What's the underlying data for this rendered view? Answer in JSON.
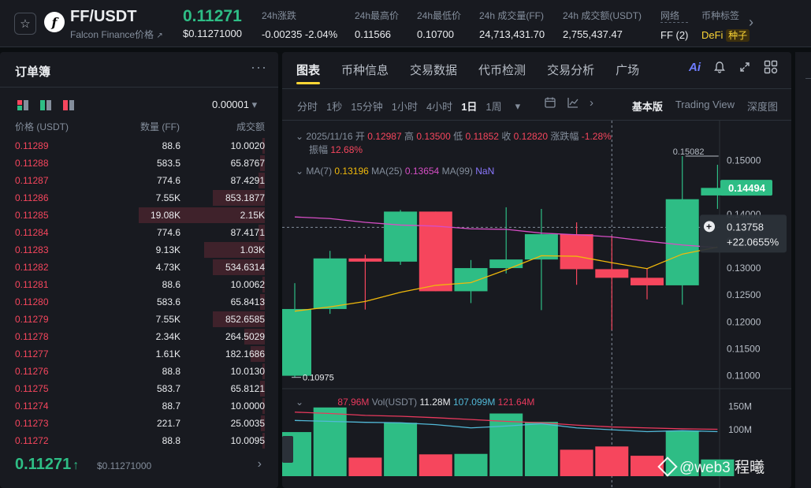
{
  "header": {
    "pair": "FF/USDT",
    "coin_name": "Falcon Finance价格",
    "coin_name_arrow": "↗",
    "logo_letter": "f",
    "last_price": "0.11271",
    "last_price_usd": "$0.11271000",
    "stats": [
      {
        "label": "24h涨跌",
        "value": "-0.00235 -2.04%",
        "tone": "down"
      },
      {
        "label": "24h最高价",
        "value": "0.11566",
        "tone": "neutral"
      },
      {
        "label": "24h最低价",
        "value": "0.10700",
        "tone": "neutral"
      },
      {
        "label": "24h 成交量(FF)",
        "value": "24,713,431.70",
        "tone": "neutral"
      },
      {
        "label": "24h 成交额(USDT)",
        "value": "2,755,437.47",
        "tone": "neutral"
      },
      {
        "label": "网络",
        "value": "FF (2)",
        "tone": "neutral"
      }
    ],
    "tags_label": "币种标签",
    "tag_defi": "DeFi",
    "tag_seed": "种子",
    "icons": {
      "favorite": "star-icon",
      "more": "chevron-right-icon"
    }
  },
  "orderbook": {
    "title": "订单簿",
    "more": "···",
    "precision": "0.00001",
    "precision_arrow": "▾",
    "columns": {
      "price": "价格 (USDT)",
      "qty": "数量 (FF)",
      "total": "成交额"
    },
    "asks": [
      {
        "price": "0.11289",
        "qty": "88.6",
        "total": "10.0020",
        "depth": 0.02
      },
      {
        "price": "0.11288",
        "qty": "583.5",
        "total": "65.8767",
        "depth": 0.04
      },
      {
        "price": "0.11287",
        "qty": "774.6",
        "total": "87.4291",
        "depth": 0.05
      },
      {
        "price": "0.11286",
        "qty": "7.55K",
        "total": "853.1877",
        "depth": 0.41
      },
      {
        "price": "0.11285",
        "qty": "19.08K",
        "total": "2.15K",
        "depth": 1.0
      },
      {
        "price": "0.11284",
        "qty": "774.6",
        "total": "87.4171",
        "depth": 0.05
      },
      {
        "price": "0.11283",
        "qty": "9.13K",
        "total": "1.03K",
        "depth": 0.48
      },
      {
        "price": "0.11282",
        "qty": "4.73K",
        "total": "534.6314",
        "depth": 0.41
      },
      {
        "price": "0.11281",
        "qty": "88.6",
        "total": "10.0062",
        "depth": 0.02
      },
      {
        "price": "0.11280",
        "qty": "583.6",
        "total": "65.8413",
        "depth": 0.04
      },
      {
        "price": "0.11279",
        "qty": "7.55K",
        "total": "852.6585",
        "depth": 0.41
      },
      {
        "price": "0.11278",
        "qty": "2.34K",
        "total": "264.5029",
        "depth": 0.16
      },
      {
        "price": "0.11277",
        "qty": "1.61K",
        "total": "182.1686",
        "depth": 0.11
      },
      {
        "price": "0.11276",
        "qty": "88.8",
        "total": "10.0130",
        "depth": 0.02
      },
      {
        "price": "0.11275",
        "qty": "583.7",
        "total": "65.8121",
        "depth": 0.04
      },
      {
        "price": "0.11274",
        "qty": "88.7",
        "total": "10.0000",
        "depth": 0.02
      },
      {
        "price": "0.11273",
        "qty": "221.7",
        "total": "25.0035",
        "depth": 0.03
      },
      {
        "price": "0.11272",
        "qty": "88.8",
        "total": "10.0095",
        "depth": 0.02
      }
    ],
    "mid_price": "0.11271",
    "mid_arrow": "↑",
    "mid_usd": "$0.11271000",
    "mid_chevron": "›"
  },
  "chart_panel": {
    "tabs": [
      "图表",
      "币种信息",
      "交易数据",
      "代币检测",
      "交易分析",
      "广场"
    ],
    "active_tab": "图表",
    "ai_label": "Ai",
    "intervals": [
      "分时",
      "1秒",
      "15分钟",
      "1小时",
      "4小时",
      "1日",
      "1周"
    ],
    "active_interval": "1日",
    "interval_more": "▾",
    "views": [
      "基本版",
      "Trading View",
      "深度图"
    ],
    "active_view": "基本版",
    "ohlc_line": {
      "date": "2025/11/16",
      "open_label": "开",
      "open": "0.12987",
      "high_label": "高",
      "high": "0.13500",
      "low_label": "低",
      "low": "0.11852",
      "close_label": "收",
      "close": "0.12820",
      "change_label": "涨跌幅",
      "change": "-1.28%",
      "amp_label": "振幅",
      "amp": "12.68%"
    },
    "ma_line": {
      "ma7_label": "MA(7)",
      "ma7": "0.13196",
      "ma25_label": "MA(25)",
      "ma25": "0.13654",
      "ma99_label": "MA(99)",
      "ma99": "NaN"
    },
    "vol_line": {
      "vol1": "87.96M",
      "vol_label": "Vol(USDT)",
      "vol2": "11.28M",
      "vol3": "107.099M",
      "vol4": "121.64M"
    },
    "price_box": "0.14494",
    "crosshair_price": "0.13758",
    "crosshair_pct": "+22.0655%",
    "high_marker": "0.15082",
    "low_marker": "0.10975",
    "watermark": "@web3  程曦"
  },
  "chart_data": {
    "type": "candlestick",
    "y_ticks": [
      "0.15000",
      "0.14000",
      "0.13500",
      "0.13000",
      "0.12500",
      "0.12000",
      "0.11500",
      "0.11000"
    ],
    "vol_ticks": [
      "150M",
      "100M"
    ],
    "ylim": [
      0.1076,
      0.1574
    ],
    "vol_lim": [
      0,
      180
    ],
    "candles": [
      {
        "o": 0.11,
        "h": 0.1272,
        "l": 0.1097,
        "c": 0.1224,
        "v": 95
      },
      {
        "o": 0.1224,
        "h": 0.1332,
        "l": 0.1215,
        "c": 0.1318,
        "v": 148
      },
      {
        "o": 0.1318,
        "h": 0.1325,
        "l": 0.1223,
        "c": 0.1312,
        "v": 40
      },
      {
        "o": 0.1312,
        "h": 0.1408,
        "l": 0.1306,
        "c": 0.1405,
        "v": 115
      },
      {
        "o": 0.1405,
        "h": 0.1405,
        "l": 0.1257,
        "c": 0.1257,
        "v": 47
      },
      {
        "o": 0.1257,
        "h": 0.1315,
        "l": 0.1235,
        "c": 0.13,
        "v": 48
      },
      {
        "o": 0.13,
        "h": 0.1413,
        "l": 0.129,
        "c": 0.1316,
        "v": 135
      },
      {
        "o": 0.1316,
        "h": 0.141,
        "l": 0.1222,
        "c": 0.1363,
        "v": 117
      },
      {
        "o": 0.1363,
        "h": 0.1385,
        "l": 0.1269,
        "c": 0.1298,
        "v": 57
      },
      {
        "o": 0.1298,
        "h": 0.136,
        "l": 0.1185,
        "c": 0.1282,
        "v": 64
      },
      {
        "o": 0.1282,
        "h": 0.13,
        "l": 0.1242,
        "c": 0.1268,
        "v": 44
      },
      {
        "o": 0.1268,
        "h": 0.1508,
        "l": 0.1232,
        "c": 0.1428,
        "v": 98
      },
      {
        "o": 0.1435,
        "h": 0.1492,
        "l": 0.141,
        "c": 0.1449,
        "v": 36
      }
    ],
    "ma7": [
      0.122,
      0.1228,
      0.1238,
      0.1255,
      0.1268,
      0.1273,
      0.1297,
      0.1323,
      0.1322,
      0.131,
      0.1299,
      0.1326,
      0.1339
    ],
    "ma25": [
      0.1395,
      0.1392,
      0.1385,
      0.138,
      0.1378,
      0.1373,
      0.1372,
      0.1365,
      0.1362,
      0.1358,
      0.135,
      0.1343,
      0.1338
    ],
    "vol_ma_a": [
      138,
      135,
      131,
      129,
      126,
      122,
      118,
      115,
      110,
      106,
      104,
      102,
      101
    ],
    "vol_ma_b": [
      120,
      118,
      116,
      115,
      111,
      104,
      108,
      113,
      104,
      100,
      96,
      98,
      96
    ]
  },
  "colors": {
    "up": "#2ebd85",
    "down": "#f6465d",
    "accent": "#fcd535",
    "ma7": "#f0b90b",
    "ma25": "#d64ec5",
    "ma99": "#8b78ff",
    "vol_ma_a": "#e8395d",
    "vol_ma_b": "#52b9d8"
  }
}
